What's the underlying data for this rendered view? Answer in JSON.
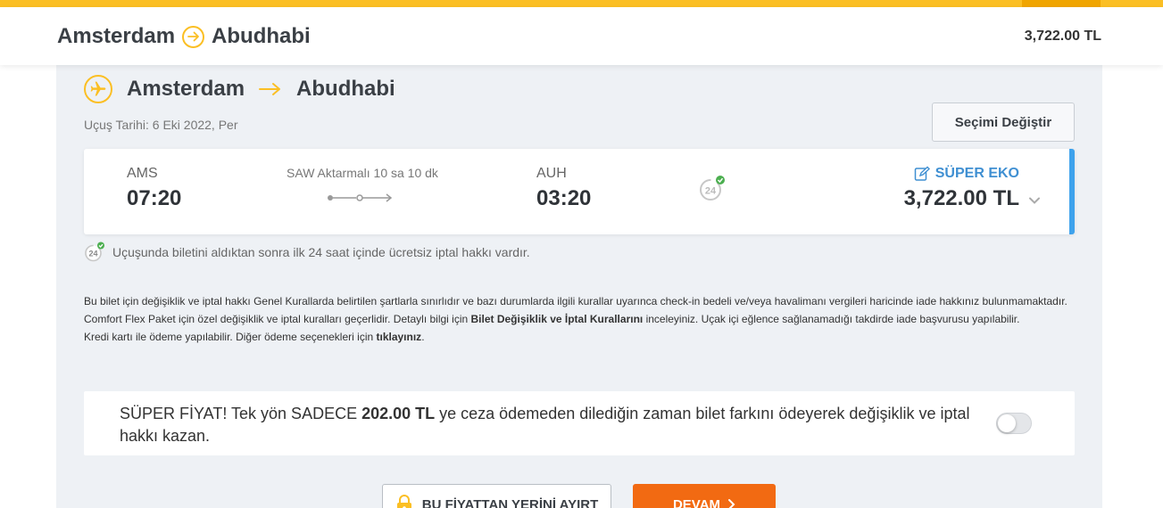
{
  "header": {
    "origin": "Amsterdam",
    "destination": "Abudhabi",
    "price": "3,722.00 TL"
  },
  "route": {
    "origin": "Amsterdam",
    "destination": "Abudhabi",
    "flight_date": "Uçuş Tarihi: 6 Eki 2022, Per",
    "change_button": "Seçimi Değiştir"
  },
  "flight": {
    "dep_code": "AMS",
    "dep_time": "07:20",
    "transfer": "SAW Aktarmalı 10 sa 10 dk",
    "arr_code": "AUH",
    "arr_time": "03:20",
    "fare_class": "SÜPER EKO",
    "fare_price": "3,722.00 TL"
  },
  "cancel_info": "Uçuşunda biletini aldıktan sonra ilk 24 saat içinde ücretsiz iptal hakkı vardır.",
  "rules": {
    "p1_a": "Bu bilet için değişiklik ve iptal hakkı Genel Kurallarda belirtilen şartlarla sınırlıdır ve bazı durumlarda ilgili kurallar uyarınca check-in bedeli ve/veya havalimanı vergileri haricinde iade hakkınız bulunmamaktadır. Comfort Flex Paket için özel değişiklik ve iptal kuralları geçerlidir. Detaylı bilgi için ",
    "p1_link": "Bilet Değişiklik ve İptal Kurallarını",
    "p1_b": " inceleyiniz. Uçak içi eğlence sağlanamadığı takdirde iade başvurusu yapılabilir.",
    "p2_a": "Kredi kartı ile ödeme yapılabilir. Diğer ödeme seçenekleri için ",
    "p2_link": "tıklayınız",
    "p2_b": "."
  },
  "promo": {
    "text_a": "SÜPER FİYAT! Tek yön SADECE ",
    "amount": "202.00 TL",
    "text_b": " ye ceza ödemeden dilediğin zaman bilet farkını ödeyerek değişiklik ve iptal hakkı kazan.",
    "toggle_on": false
  },
  "actions": {
    "reserve": "BU FİYATTAN YERİNİ AYIRT",
    "continue": "DEVAM"
  },
  "colors": {
    "accent": "#fbbf24",
    "primary_button": "#f26a12",
    "fare_blue": "#3f8fd2",
    "card_border": "#3ea2ec"
  }
}
